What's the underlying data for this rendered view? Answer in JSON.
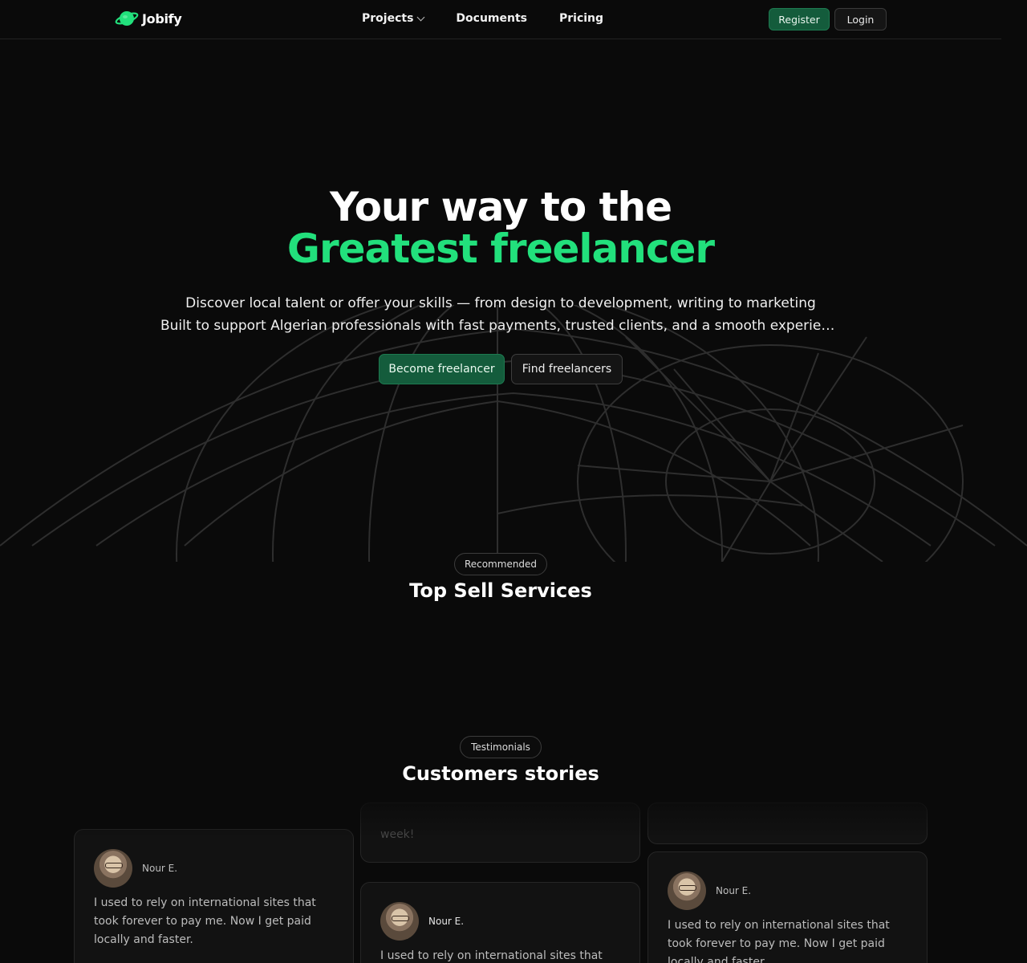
{
  "brand": {
    "name": "Jobify",
    "accent": "#22e07c",
    "button_green": "#145c3c",
    "background": "#0a0a0a"
  },
  "nav": {
    "links": [
      {
        "label": "Projects",
        "has_dropdown": true
      },
      {
        "label": "Documents"
      },
      {
        "label": "Pricing"
      }
    ],
    "register_label": "Register",
    "login_label": "Login"
  },
  "hero": {
    "title_line1": "Your way to the",
    "title_line2": "Greatest freelancer",
    "subtitle_line1": "Discover local talent or offer your skills — from design to development, writing to marketing",
    "subtitle_line2": "Built to support Algerian professionals with fast payments, trusted clients, and a smooth experien...",
    "primary_cta": "Become freelancer",
    "secondary_cta": "Find freelancers"
  },
  "services": {
    "badge": "Recommended",
    "title": "Top Sell Services"
  },
  "testimonials": {
    "badge": "Testimonials",
    "title": "Customers stories",
    "partial_text": "week!",
    "cards": [
      {
        "author": "Nour E.",
        "quote": "I used to rely on international sites that took forever to pay me. Now I get paid locally and faster."
      },
      {
        "author": "Nour E.",
        "quote": "I used to rely on international sites that took forever to pay me. Now I get paid locally and faster."
      },
      {
        "author": "Nour E.",
        "quote": "I used to rely on international sites that took forever to pay me. Now I get paid locally and faster."
      }
    ]
  }
}
